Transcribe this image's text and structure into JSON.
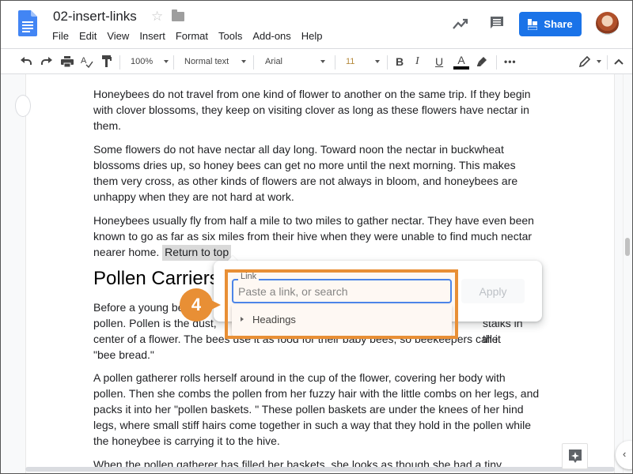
{
  "header": {
    "title": "02-insert-links",
    "menu": [
      "File",
      "Edit",
      "View",
      "Insert",
      "Format",
      "Tools",
      "Add-ons",
      "Help"
    ],
    "share_label": "Share",
    "icons": {
      "logo": "google-docs-icon",
      "star": "star-icon",
      "folder": "folder-icon",
      "activity": "activity-trend-icon",
      "comment": "comment-icon",
      "share": "lock-people-icon",
      "avatar": "user-avatar"
    },
    "colors": {
      "share_bg": "#1a73e8",
      "logo": "#4285f4"
    }
  },
  "toolbar": {
    "zoom": "100%",
    "style": "Normal text",
    "font": "Arial",
    "font_size": "11",
    "icons": [
      "undo-icon",
      "redo-icon",
      "print-icon",
      "spellcheck-icon",
      "paint-format-icon",
      "bold-icon",
      "italic-icon",
      "underline-icon",
      "text-color-icon",
      "highlight-icon",
      "more-icon",
      "editing-mode-icon",
      "collapse-icon"
    ],
    "bold": "B",
    "italic": "I",
    "underline": "U",
    "text_color": "A",
    "more": "•••"
  },
  "document": {
    "paragraphs": [
      "Honeybees do not travel from one kind of flower to another on the same trip. If they begin with clover blossoms, they keep on visiting clover as long as these flowers have nectar in them.",
      "Some flowers do not have nectar all day long. Toward noon the nectar in buckwheat blossoms dries up, so honey bees can get no more until the next morning. This makes them very cross, as other kinds of flowers are not always in bloom, and honeybees are unhappy when they are not hard at work.",
      "Honeybees usually fly from half a mile to two miles to gather nectar. They have even been known to go as far as six miles from their hive when they were unable to find much nectar nearer home."
    ],
    "selected_text": "Return to top",
    "heading": "Pollen Carriers",
    "para4_lines": [
      "Before a young bee",
      "pollen. Pollen is the dust,",
      "stalks in the",
      "center of a flower. The bees use it as food for their baby bees, so beekeepers call it",
      "\"bee bread.\""
    ],
    "para5": "A pollen gatherer rolls herself around in the cup of the flower, covering her body with pollen. Then she combs the pollen from her fuzzy hair with the little combs on her legs, and packs it into her \"pollen baskets. \" These pollen baskets are under the knees of her hind legs, where small stiff hairs come together in such a way that they hold in the pollen while the honeybee is carrying it to the hive.",
    "para6_partial": "When the pollen gatherer has filled her baskets, she looks as though she had a tiny"
  },
  "link_popup": {
    "label": "Link",
    "placeholder": "Paste a link, or search",
    "value": "",
    "apply_label": "Apply",
    "dropdown_items": [
      "Headings"
    ]
  },
  "annotation": {
    "step": "4",
    "color": "#e88f35"
  }
}
